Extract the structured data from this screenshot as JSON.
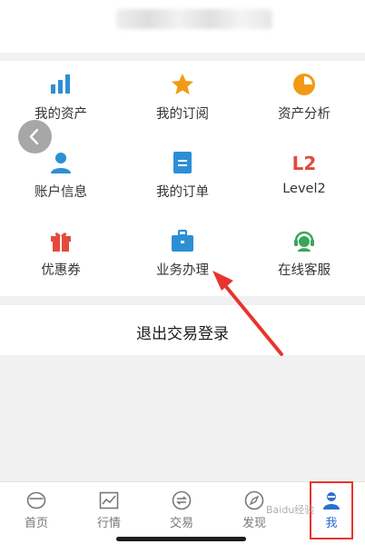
{
  "header": {
    "title_blurred": ""
  },
  "grid": {
    "items": [
      {
        "label": "我的资产",
        "icon": "bar-chart-icon",
        "color": "#2c8fd6"
      },
      {
        "label": "我的订阅",
        "icon": "star-icon",
        "color": "#f29a15"
      },
      {
        "label": "资产分析",
        "icon": "pie-chart-icon",
        "color": "#f29a15"
      },
      {
        "label": "账户信息",
        "icon": "user-icon",
        "color": "#2c8fd6"
      },
      {
        "label": "我的订单",
        "icon": "order-icon",
        "color": "#2c8fd6"
      },
      {
        "label": "Level2",
        "icon": "l2-icon",
        "icon_text": "L2",
        "color": "#e34a3c"
      },
      {
        "label": "优惠券",
        "icon": "gift-icon",
        "color": "#e34a3c"
      },
      {
        "label": "业务办理",
        "icon": "briefcase-icon",
        "color": "#2c8fd6"
      },
      {
        "label": "在线客服",
        "icon": "customer-service-icon",
        "color": "#3aa65a"
      }
    ]
  },
  "logout": {
    "label": "退出交易登录"
  },
  "tabbar": {
    "items": [
      {
        "label": "首页",
        "icon": "home-icon",
        "active": false
      },
      {
        "label": "行情",
        "icon": "market-chart-icon",
        "active": false
      },
      {
        "label": "交易",
        "icon": "trade-exchange-icon",
        "active": false
      },
      {
        "label": "发现",
        "icon": "compass-icon",
        "active": false
      },
      {
        "label": "我",
        "icon": "profile-icon",
        "active": true
      }
    ]
  },
  "annotation": {
    "arrow_color": "#e8342e",
    "box_color": "#e8342e"
  },
  "watermark": {
    "text": "Baidu经验"
  },
  "colors": {
    "accent_blue": "#2a6fd1",
    "divider_gray": "#f1f1f1"
  }
}
